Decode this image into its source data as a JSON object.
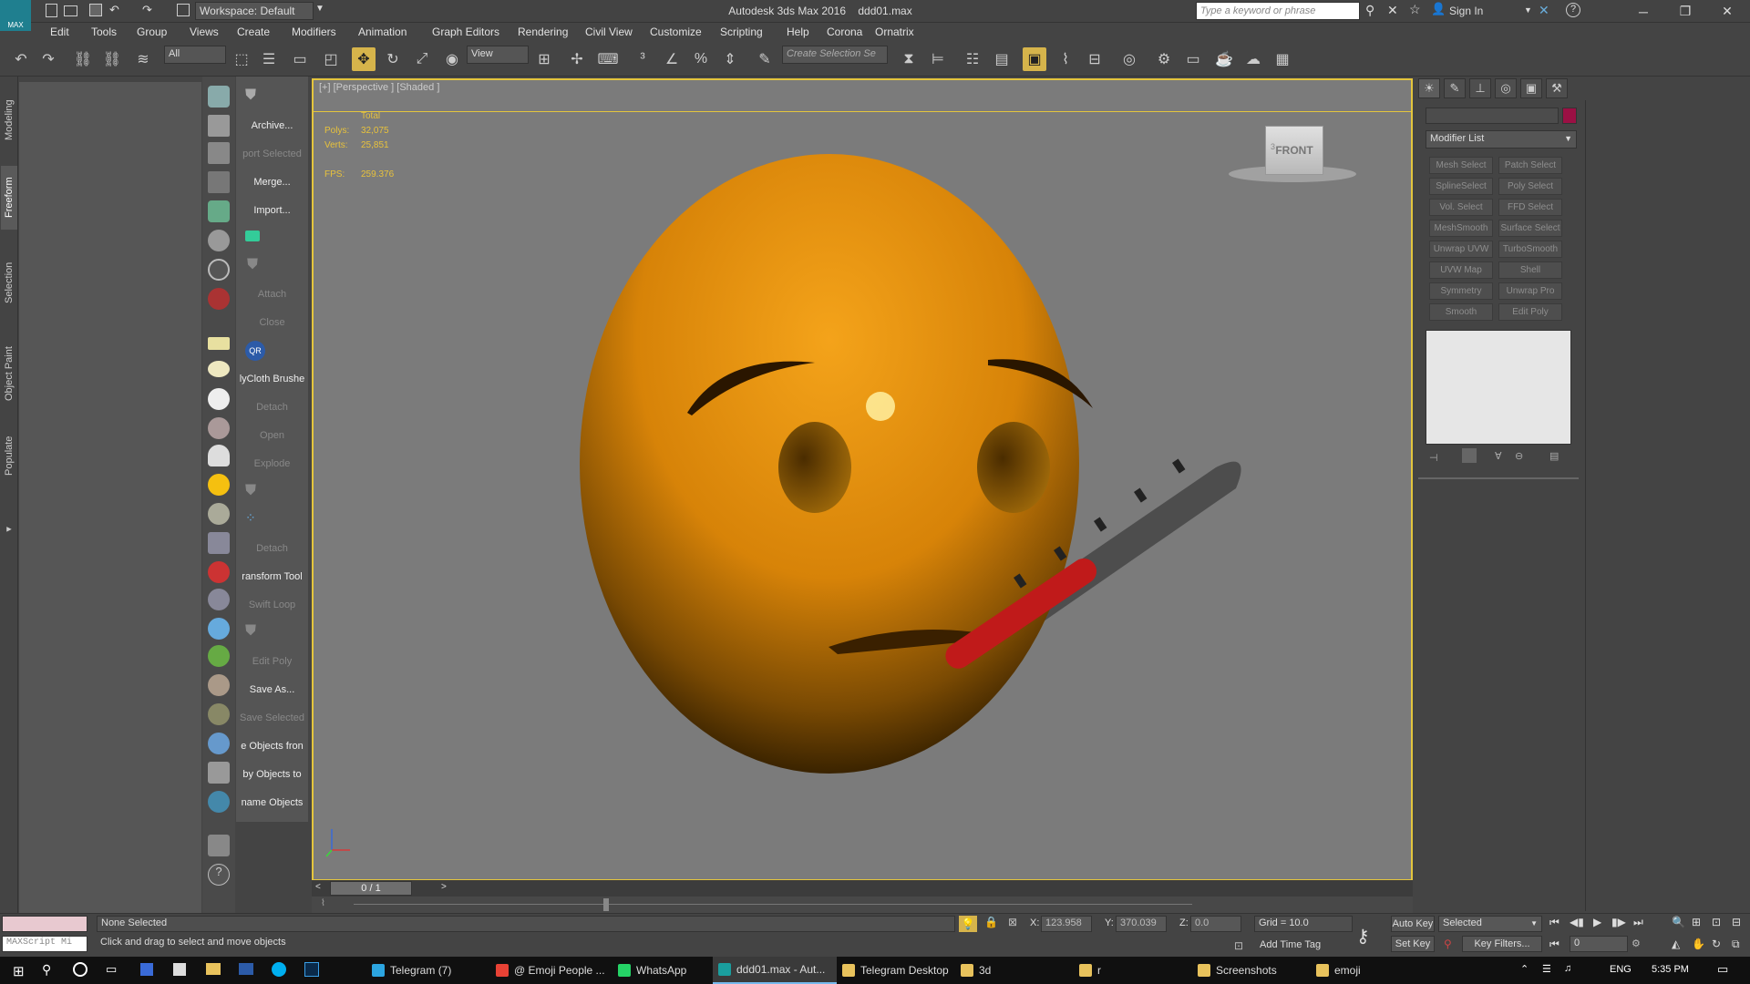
{
  "window": {
    "title": "Autodesk 3ds Max 2016",
    "file": "ddd01.max",
    "workspace": "Workspace: Default",
    "search_placeholder": "Type a keyword or phrase",
    "sign_in": "Sign In",
    "logo": "MAX"
  },
  "menu": [
    "Edit",
    "Tools",
    "Group",
    "Views",
    "Create",
    "Modifiers",
    "Animation",
    "Graph Editors",
    "Rendering",
    "Civil View",
    "Customize",
    "Scripting",
    "Help",
    "Corona",
    "Ornatrix"
  ],
  "toolbar": {
    "filter_value": "All",
    "refcoord_value": "View",
    "selection_set_placeholder": "Create Selection Se"
  },
  "ribbon_tabs": [
    "Modeling",
    "Freeform",
    "Selection",
    "Object Paint",
    "Populate"
  ],
  "ribbon_selected": "Freeform",
  "commands": [
    {
      "label": "Archive...",
      "on": true
    },
    {
      "label": "port Selected",
      "on": false
    },
    {
      "label": "Merge...",
      "on": true
    },
    {
      "label": "Import...",
      "on": true
    },
    {
      "label": "Attach",
      "on": false
    },
    {
      "label": "Close",
      "on": false
    },
    {
      "label": "lyCloth Brushe",
      "on": true
    },
    {
      "label": "Detach",
      "on": false
    },
    {
      "label": "Open",
      "on": false
    },
    {
      "label": "Explode",
      "on": false
    },
    {
      "label": "Detach",
      "on": false
    },
    {
      "label": "ransform Tool",
      "on": true
    },
    {
      "label": "Swift Loop",
      "on": false
    },
    {
      "label": "Edit Poly",
      "on": false
    },
    {
      "label": "Save As...",
      "on": true
    },
    {
      "label": "Save Selected",
      "on": false
    },
    {
      "label": "e Objects fron",
      "on": true
    },
    {
      "label": "by Objects to",
      "on": true
    },
    {
      "label": "name Objects",
      "on": true
    }
  ],
  "qr_label": "QR",
  "viewport": {
    "label": "[+] [Perspective ] [Shaded ]",
    "stats_header": "Total",
    "polys_label": "Polys:",
    "polys_value": "32,075",
    "verts_label": "Verts:",
    "verts_value": "25,851",
    "fps_label": "FPS:",
    "fps_value": "259.376",
    "viewcube_label": "FRONT",
    "viewcube_side": "3"
  },
  "command_panel": {
    "modifier_list": "Modifier List",
    "modifier_buttons": [
      "Mesh Select",
      "Patch Select",
      "SplineSelect",
      "Poly Select",
      "Vol. Select",
      "FFD Select",
      "MeshSmooth",
      "Surface Select",
      "Unwrap UVW",
      "TurboSmooth",
      "UVW Map",
      "Shell",
      "Symmetry",
      "Unwrap Pro",
      "Smooth",
      "Edit Poly"
    ],
    "color_swatch": "#9b1044"
  },
  "timeline": {
    "frame": "0 / 1"
  },
  "status": {
    "maxscript": "MAXScript Mi",
    "selection": "None Selected",
    "prompt": "Click and drag to select and move objects",
    "x_label": "X:",
    "x_value": "123.958",
    "y_label": "Y:",
    "y_value": "370.039",
    "z_label": "Z:",
    "z_value": "0.0",
    "grid": "Grid = 10.0",
    "add_time_tag": "Add Time Tag",
    "auto_key": "Auto Key",
    "set_key": "Set Key",
    "selected_dropdown": "Selected",
    "key_filters": "Key Filters...",
    "frame_field": "0"
  },
  "taskbar": {
    "items": [
      {
        "label": "Telegram (7)",
        "color": "#2ca5e0"
      },
      {
        "label": "@ Emoji People ...",
        "color": "#e84235"
      },
      {
        "label": "WhatsApp",
        "color": "#25d366"
      },
      {
        "label": "ddd01.max - Aut...",
        "color": "#1a9e9e"
      },
      {
        "label": "Telegram Desktop",
        "color": "#e8c25c"
      },
      {
        "label": "3d",
        "color": "#e8c25c"
      },
      {
        "label": "r",
        "color": "#e8c25c"
      },
      {
        "label": "Screenshots",
        "color": "#e8c25c"
      },
      {
        "label": "emoji",
        "color": "#e8c25c"
      }
    ],
    "lang": "ENG",
    "time": "5:35 PM"
  },
  "colors": {
    "viewport_border": "#e4c53d",
    "emoji_face": "#e3900f",
    "thermometer_bulb": "#c01a1a"
  }
}
